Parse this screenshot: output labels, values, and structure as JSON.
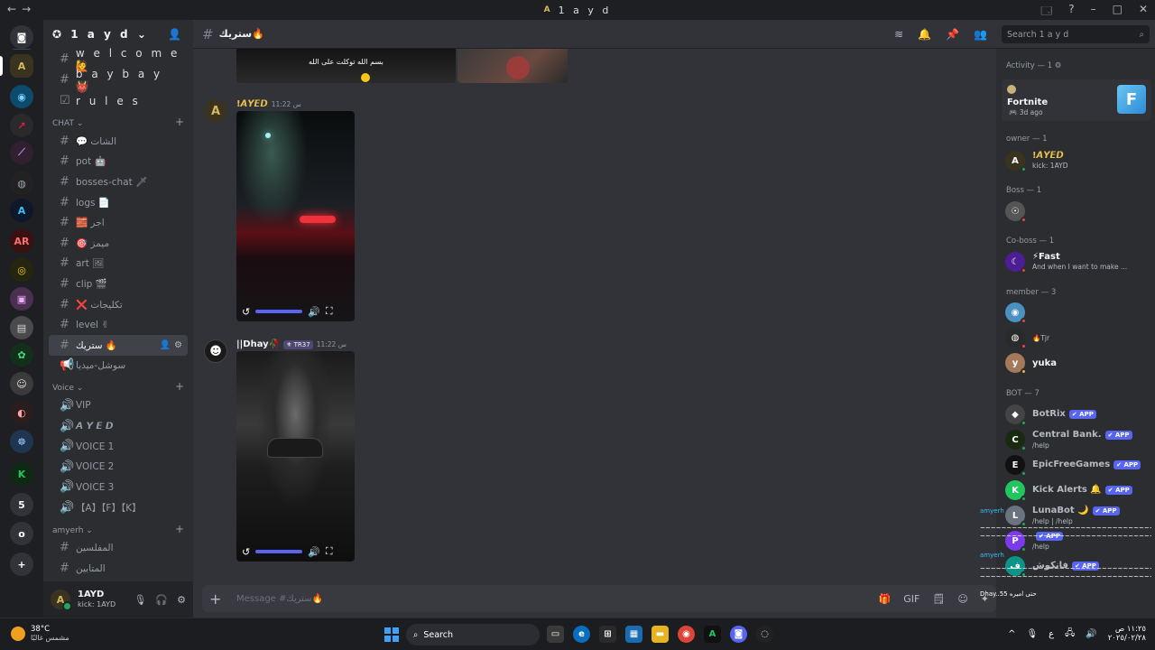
{
  "window": {
    "title": "1 a y d",
    "nav_back": "←",
    "nav_fwd": "→",
    "buttons": [
      "🗔",
      "?",
      "–",
      "□",
      "✕"
    ]
  },
  "servers": [
    {
      "label": "◙",
      "color": "#313338",
      "fg": "#ffffff"
    },
    {
      "label": "A",
      "color": "#3a3320",
      "fg": "#d4b85a"
    },
    {
      "label": "◉",
      "color": "#0c4a6e",
      "fg": "#7dd3fc"
    },
    {
      "label": "↗",
      "color": "#2a2a2a",
      "fg": "#e11d48"
    },
    {
      "label": "⟋",
      "color": "#302030",
      "fg": "#c084fc"
    },
    {
      "label": "◍",
      "color": "#222222",
      "fg": "#9ca3af"
    },
    {
      "label": "A",
      "color": "#0f172a",
      "fg": "#38bdf8"
    },
    {
      "label": "AR",
      "color": "#3a1010",
      "fg": "#f87171"
    },
    {
      "label": "◎",
      "color": "#262510",
      "fg": "#facc15"
    },
    {
      "label": "▣",
      "color": "#4a3050",
      "fg": "#f0abfc"
    },
    {
      "label": "▤",
      "color": "#4a4a4a",
      "fg": "#d1d5db"
    },
    {
      "label": "✿",
      "color": "#12301a",
      "fg": "#4ade80"
    },
    {
      "label": "☺",
      "color": "#3b3b3b",
      "fg": "#e5e7eb"
    },
    {
      "label": "◐",
      "color": "#2b1d1d",
      "fg": "#fca5a5"
    },
    {
      "label": "☸",
      "color": "#1f3550",
      "fg": "#93c5fd"
    },
    {
      "label": "K",
      "color": "#0f2a14",
      "fg": "#22c55e"
    },
    {
      "label": "5",
      "color": "#313338",
      "fg": "#ffffff"
    },
    {
      "label": "o",
      "color": "#313338",
      "fg": "#ffffff"
    },
    {
      "label": "+",
      "color": "#313338",
      "fg": "#ffffff"
    }
  ],
  "guild": {
    "name": "1 a y d",
    "chevron": "⌄"
  },
  "sidebar": {
    "top_channels": [
      {
        "name": "w e l c o m e 🙋",
        "icon": "#"
      },
      {
        "name": "b a y b a y 👹",
        "icon": "#"
      },
      {
        "name": "r u l e s",
        "icon": "☑"
      }
    ],
    "cat_chat": "CHAT ⌄",
    "chat_channels": [
      {
        "name": "💬 الشات",
        "icon": "#"
      },
      {
        "name": "pot 🤖",
        "icon": "#"
      },
      {
        "name": "bosses-chat 🗡",
        "icon": "#"
      },
      {
        "name": "logs 📄",
        "icon": "#"
      },
      {
        "name": "🧱 اجر",
        "icon": "#"
      },
      {
        "name": "🎯 ميمز",
        "icon": "#"
      },
      {
        "name": "art 🖼",
        "icon": "#"
      },
      {
        "name": "clip 🎬",
        "icon": "#"
      },
      {
        "name": "❌ تكليجات",
        "icon": "#"
      },
      {
        "name": "level ✌",
        "icon": "#"
      },
      {
        "name": "ستريك 🔥",
        "icon": "#",
        "selected": true
      },
      {
        "name": "سوشل-ميديا",
        "icon": "📢"
      }
    ],
    "cat_voice": "Voice ⌄",
    "voice_channels": [
      {
        "name": "VIP",
        "icon": "🔊"
      },
      {
        "name": "𝘼 𝙔 𝙀 𝘿",
        "icon": "🔊"
      },
      {
        "name": "VOICE 1",
        "icon": "🔊"
      },
      {
        "name": "VOICE 2",
        "icon": "🔊"
      },
      {
        "name": "VOICE 3",
        "icon": "🔊"
      },
      {
        "name": "【A】【F】【K】",
        "icon": "🔊"
      }
    ],
    "cat_amyerh": "amyerh ⌄",
    "amyerh_channels": [
      {
        "name": "المفلسين",
        "icon": "#"
      },
      {
        "name": "المتابين",
        "icon": "#"
      }
    ]
  },
  "user": {
    "name": "1AYD",
    "status": "kick: 1AYD",
    "avatar": "A"
  },
  "chat": {
    "channel": "ستريك🔥",
    "header_icons": [
      "≋",
      "🔔",
      "📌",
      "👥"
    ],
    "search_placeholder": "Search 1 a y d",
    "prev_caption": "بسم الله توكلت على الله",
    "messages": [
      {
        "username": "!𝘼𝙔𝙀𝘿",
        "time": "س 11:22",
        "color": "#e9c14a",
        "avatar": "A",
        "avatar_bg": "#3a3320"
      },
      {
        "username": "||Dhay🥀",
        "tag": "⚜ TR37",
        "time": "س 11:22",
        "color": "#f2f3f5",
        "avatar": "☻",
        "avatar_bg": "#1a1a1a"
      }
    ],
    "composer_placeholder": "Message #ستريك🔥",
    "composer_tools": [
      "🎁",
      "GIF",
      "🗒",
      "☺",
      "✦"
    ]
  },
  "members": {
    "activity_header": "Activity — 1 ⚙",
    "activity_game": "Fortnite",
    "activity_ago": "🎮 3d ago",
    "activity_art": "F",
    "owner_header": "owner — 1",
    "owner": {
      "name": "!𝘼𝙔𝙀𝘿",
      "status": "kick: 1AYD",
      "color": "#e9c14a",
      "av": "A",
      "av_bg": "#3a3320",
      "st": "#23a55a"
    },
    "boss_header": "Boss — 1",
    "boss": {
      "name": "",
      "color": "#80848e",
      "av": "☉",
      "av_bg": "#555555",
      "st": "#f23f43"
    },
    "coboss_header": "Co-boss — 1",
    "coboss": {
      "name": "⚡Fast",
      "status": "And when I want to make ...",
      "color": "#f2f3f5",
      "av": "☾",
      "av_bg": "#4c1d95",
      "st": "#f23f43"
    },
    "member_header": "member — 3",
    "member_list": [
      {
        "name": "",
        "color": "#b83232",
        "av": "◉",
        "av_bg": "#4a90c0",
        "st": "#f23f43"
      },
      {
        "name": "",
        "status": "🔥Tjr",
        "color": "#3b47b8",
        "av": "◍",
        "av_bg": "#2a2a2a",
        "st": "#f23f43"
      },
      {
        "name": "yuka",
        "color": "#f2f3f5",
        "av": "y",
        "av_bg": "#a47a5a",
        "st": "#f0b232"
      }
    ],
    "bot_header": "BOT — 7",
    "app_label": "✔ APP",
    "bots": [
      {
        "name": "BotRix",
        "status": "",
        "color": "#b5bac1",
        "av": "◆",
        "av_bg": "#444444",
        "st": "#23a55a"
      },
      {
        "name": "Central Bank.",
        "status": "/help",
        "color": "#b5bac1",
        "av": "C",
        "av_bg": "#1a2a10",
        "st": "#23a55a"
      },
      {
        "name": "EpicFreeGames",
        "status": "",
        "color": "#b5bac1",
        "av": "E",
        "av_bg": "#111111",
        "st": "#23a55a"
      },
      {
        "name": "Kick Alerts 🔔",
        "status": "",
        "color": "#b5bac1",
        "av": "K",
        "av_bg": "#22c55e",
        "st": "#23a55a"
      },
      {
        "name": "LunaBot 🌙",
        "status": "/help | /help",
        "color": "#b5bac1",
        "av": "L",
        "av_bg": "#6b7280",
        "st": "#23a55a"
      },
      {
        "name": "",
        "status": "/help",
        "color": "#b5bac1",
        "av": "P",
        "av_bg": "#7c3aed",
        "st": "#23a55a"
      },
      {
        "name": "فانكوش",
        "status": "",
        "color": "#b5bac1",
        "av": "ف",
        "av_bg": "#0d9488",
        "st": "#23a55a"
      }
    ]
  },
  "overlay": {
    "line1": "amyerh",
    "line2": "amyerh",
    "line3": "Dhay..55 حتى اميره",
    "noise": "~~~~~~~~~~~~~~~~~~~~~~~~~~~~~~~~~~~~~~~~~~~~~~~~~~~~~"
  },
  "taskbar": {
    "temp": "38°C",
    "weather": "مشمس غالبًا",
    "search": "Search",
    "clock_time": "١١:٢٥ ص",
    "clock_date": "٢٠٢٥/٠٢/٢٨",
    "lang": "ع",
    "tray": [
      "^",
      "🎙",
      "ع",
      "🖧",
      "🔊"
    ]
  }
}
